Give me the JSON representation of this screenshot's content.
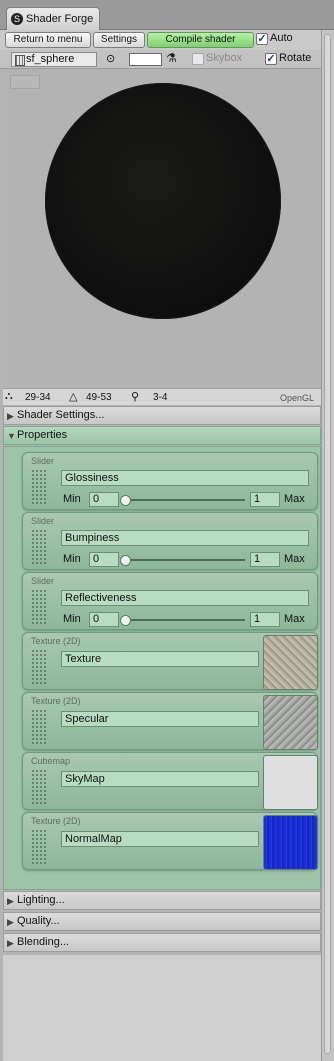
{
  "window": {
    "title": "Shader Forge"
  },
  "toolbar": {
    "return_label": "Return to menu",
    "settings_label": "Settings",
    "compile_label": "Compile shader",
    "auto_label": "Auto",
    "auto_checked": true
  },
  "preview_bar": {
    "mesh": "sf_sphere",
    "skybox_label": "Skybox",
    "skybox_checked": false,
    "rotate_label": "Rotate",
    "rotate_checked": true
  },
  "stats": {
    "verts": "29-34",
    "tris": "49-53",
    "passes": "3-4",
    "renderer": "OpenGL"
  },
  "sections": {
    "shader_settings": "Shader Settings...",
    "properties": "Properties",
    "lighting": "Lighting...",
    "quality": "Quality...",
    "blending": "Blending..."
  },
  "properties": [
    {
      "type": "Slider",
      "name": "Glossiness",
      "min_label": "Min",
      "min": "0",
      "max": "1",
      "max_label": "Max"
    },
    {
      "type": "Slider",
      "name": "Bumpiness",
      "min_label": "Min",
      "min": "0",
      "max": "1",
      "max_label": "Max"
    },
    {
      "type": "Slider",
      "name": "Reflectiveness",
      "min_label": "Min",
      "min": "0",
      "max": "1",
      "max_label": "Max"
    },
    {
      "type": "Texture (2D)",
      "name": "Texture"
    },
    {
      "type": "Texture (2D)",
      "name": "Specular"
    },
    {
      "type": "Cubemap",
      "name": "SkyMap"
    },
    {
      "type": "Texture (2D)",
      "name": "NormalMap"
    }
  ],
  "colors": {
    "accent_green": "#9cc4a8",
    "compile_green": "#7fcf72",
    "normal_map_blue": "#1a2fd6"
  }
}
